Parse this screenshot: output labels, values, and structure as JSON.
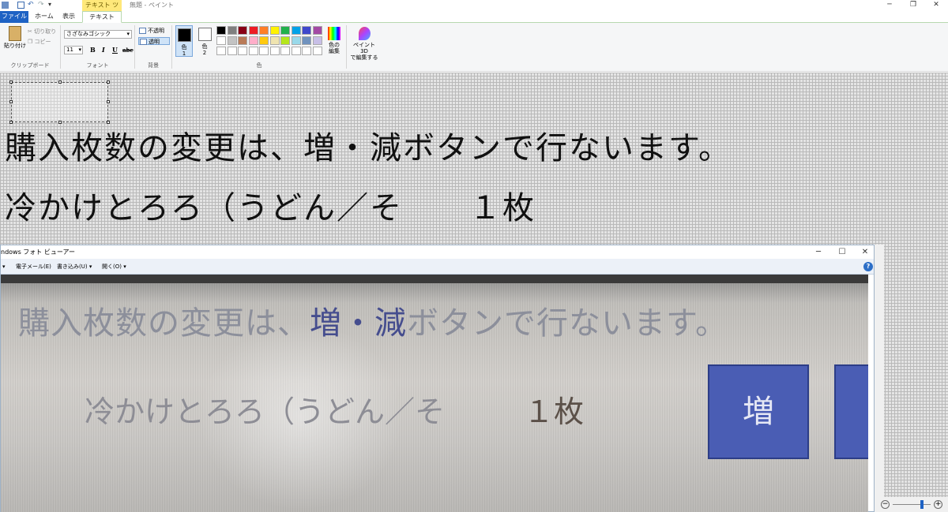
{
  "titlebar": {
    "context_tab": "テキスト ツール",
    "doc_title": "無題 - ペイント",
    "minimize_icon": "minimize-icon",
    "restore_icon": "restore-icon",
    "close_icon": "close-icon"
  },
  "tabs": {
    "file": "ファイル",
    "home": "ホーム",
    "view": "表示",
    "text": "テキスト"
  },
  "ribbon": {
    "clipboard": {
      "paste": "貼り付け",
      "cut": "切り取り",
      "copy": "コピー",
      "label": "クリップボード"
    },
    "font": {
      "family": "さざなみゴシック",
      "size": "11",
      "bold": "B",
      "italic": "I",
      "underline": "U",
      "strike": "abc",
      "label": "フォント"
    },
    "background": {
      "opaque": "不透明",
      "transparent": "透明",
      "label": "背景"
    },
    "colors": {
      "color1": "色",
      "color1_num": "1",
      "color2": "色",
      "color2_num": "2",
      "color1_value": "#000000",
      "color2_value": "#ffffff",
      "edit_colors_line1": "色の",
      "edit_colors_line2": "編集",
      "label": "色",
      "palette": [
        "#000000",
        "#7f7f7f",
        "#880015",
        "#ed1c24",
        "#ff7f27",
        "#fff200",
        "#22b14c",
        "#00a2e8",
        "#3f48cc",
        "#a349a4",
        "#ffffff",
        "#c3c3c3",
        "#b97a57",
        "#ffaec9",
        "#ffc90e",
        "#efe4b0",
        "#b5e61d",
        "#99d9ea",
        "#7092be",
        "#c8bfe7"
      ]
    },
    "paint3d": {
      "line1": "ペイント 3D",
      "line2": "で編集する"
    }
  },
  "canvas": {
    "line1": "購入枚数の変更は、増・減ボタンで行ないます。",
    "line2": "冷かけとろろ（うどん／そ　　１枚"
  },
  "viewer": {
    "title": "ndows フォト ビューアー",
    "menu_first_arrow": "▾",
    "menu": [
      "電子メール(E)",
      "書き込み(U)",
      "開く(O)"
    ],
    "help": "?",
    "photo": {
      "line1_gray_a": "購入枚数の変更は、",
      "line1_blue_a": "増・減",
      "line1_gray_b": "ボタンで行ないます。",
      "line2_text": "冷かけとろろ（うどん／そ",
      "line2_count": "１枚",
      "button_zou": "増"
    }
  },
  "zoom": {
    "minus": "−",
    "plus": "+"
  }
}
